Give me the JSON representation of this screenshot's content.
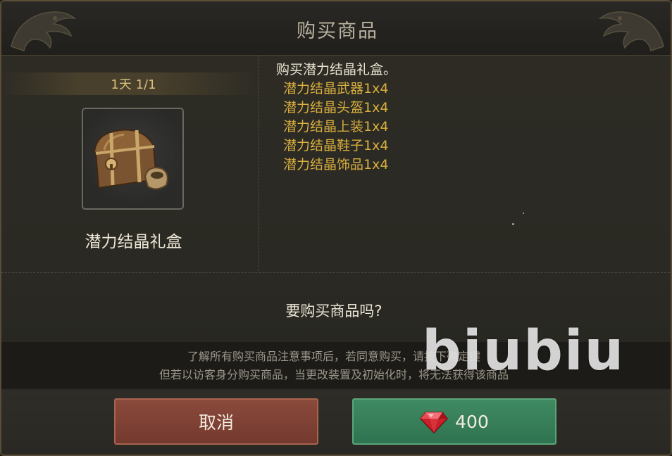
{
  "dialog": {
    "title": "购买商品"
  },
  "item": {
    "limit": "1天 1/1",
    "name": "潜力结晶礼盒",
    "icon": "treasure-chest-icon"
  },
  "description": {
    "title": "购买潜力结晶礼盒。",
    "lines": [
      "潜力结晶武器1x4",
      "潜力结晶头盔1x4",
      "潜力结晶上装1x4",
      "潜力结晶鞋子1x4",
      "潜力结晶饰品1x4"
    ]
  },
  "confirm": {
    "question": "要购买商品吗?",
    "notice_line1": "了解所有购买商品注意事项后，若同意购买，请按下确定键",
    "notice_line2": "但若以访客身分购买商品，当更改装置及初始化时，将无法获得该商品"
  },
  "buttons": {
    "cancel_label": "取消",
    "buy_price": "400",
    "buy_icon": "red-gem-icon"
  },
  "watermark": "biubiu",
  "colors": {
    "accent_gold": "#d8ae3e",
    "cancel_red": "#7e4134",
    "buy_green": "#367e58"
  }
}
